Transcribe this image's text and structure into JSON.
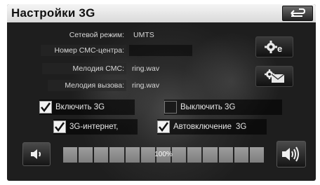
{
  "window": {
    "title": "Настройки 3G"
  },
  "info": {
    "network_mode_label": "Сетевой режим:",
    "network_mode_value": "UMTS",
    "sms_center_label": "Номер СМС-центра:",
    "sms_center_value": "",
    "sms_melody_label": "Мелодия СМС:",
    "sms_melody_value": "ring.wav",
    "call_melody_label": "Мелодия вызова:",
    "call_melody_value": "ring.wav"
  },
  "options": {
    "enable_3g": {
      "label": "Включить 3G",
      "checked": true
    },
    "disable_3g": {
      "label": "Выключить 3G",
      "checked": false
    },
    "internet_3g": {
      "label": "3G-интернет,",
      "checked": true
    },
    "auto_enable": {
      "label": "Автовключение",
      "suffix": "3G",
      "checked": true
    }
  },
  "volume": {
    "percent_label": "100%",
    "level": 1.0,
    "segments": 13
  },
  "icons": {
    "back": "return-arrow-icon",
    "settings": "gear-e-icon",
    "messages": "envelope-gear-icon",
    "vol_down": "speaker-low-icon",
    "vol_up": "speaker-high-icon",
    "check": "checkmark-icon"
  }
}
